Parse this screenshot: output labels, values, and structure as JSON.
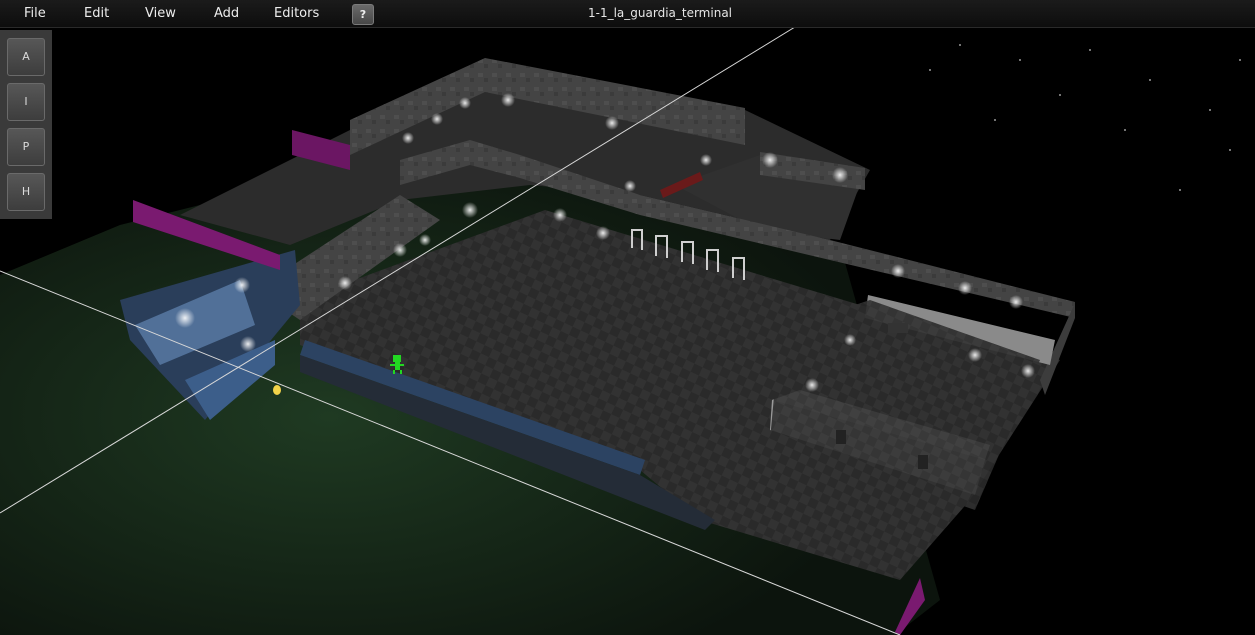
{
  "menubar": {
    "items": [
      "File",
      "Edit",
      "View",
      "Add",
      "Editors"
    ],
    "help_label": "?",
    "document_title": "1-1_la_guardia_terminal"
  },
  "palette": {
    "buttons": [
      "A",
      "I",
      "P",
      "H"
    ]
  },
  "colors": {
    "background": "#000000",
    "menubar": "#141414",
    "palette": "#3a3a3a",
    "floor": "#2b2b2b",
    "wall": "#4a4a4a",
    "accent_magenta": "#8a1f7e",
    "accent_green": "#22d822",
    "light_yellow": "#f3d34a"
  }
}
